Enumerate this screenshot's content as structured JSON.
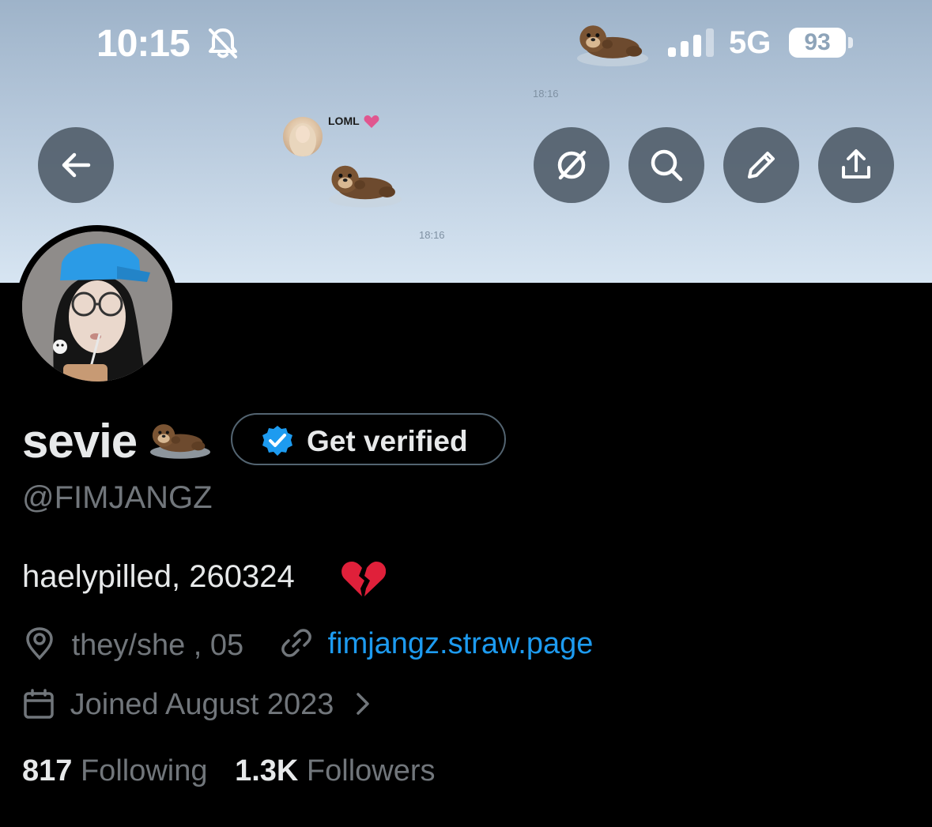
{
  "status_bar": {
    "time": "10:15",
    "network": "5G",
    "battery": "93"
  },
  "banner_chat": {
    "time_top": "18:16",
    "name": "LOML",
    "time_bottom": "18:16"
  },
  "profile": {
    "display_name": "sevie",
    "verify_label": "Get verified",
    "handle": "@FIMJANGZ",
    "bio": "haelypilled, 260324",
    "location": "they/she , 05",
    "website": "fimjangz.straw.page",
    "joined": "Joined August 2023"
  },
  "stats": {
    "following_count": "817",
    "following_label": "Following",
    "followers_count": "1.3K",
    "followers_label": "Followers"
  },
  "colors": {
    "background": "#000000",
    "primary_text": "#e7e9ea",
    "secondary_text": "#71767b",
    "link": "#1d9bf0",
    "verified_badge": "#1d9bf0"
  }
}
